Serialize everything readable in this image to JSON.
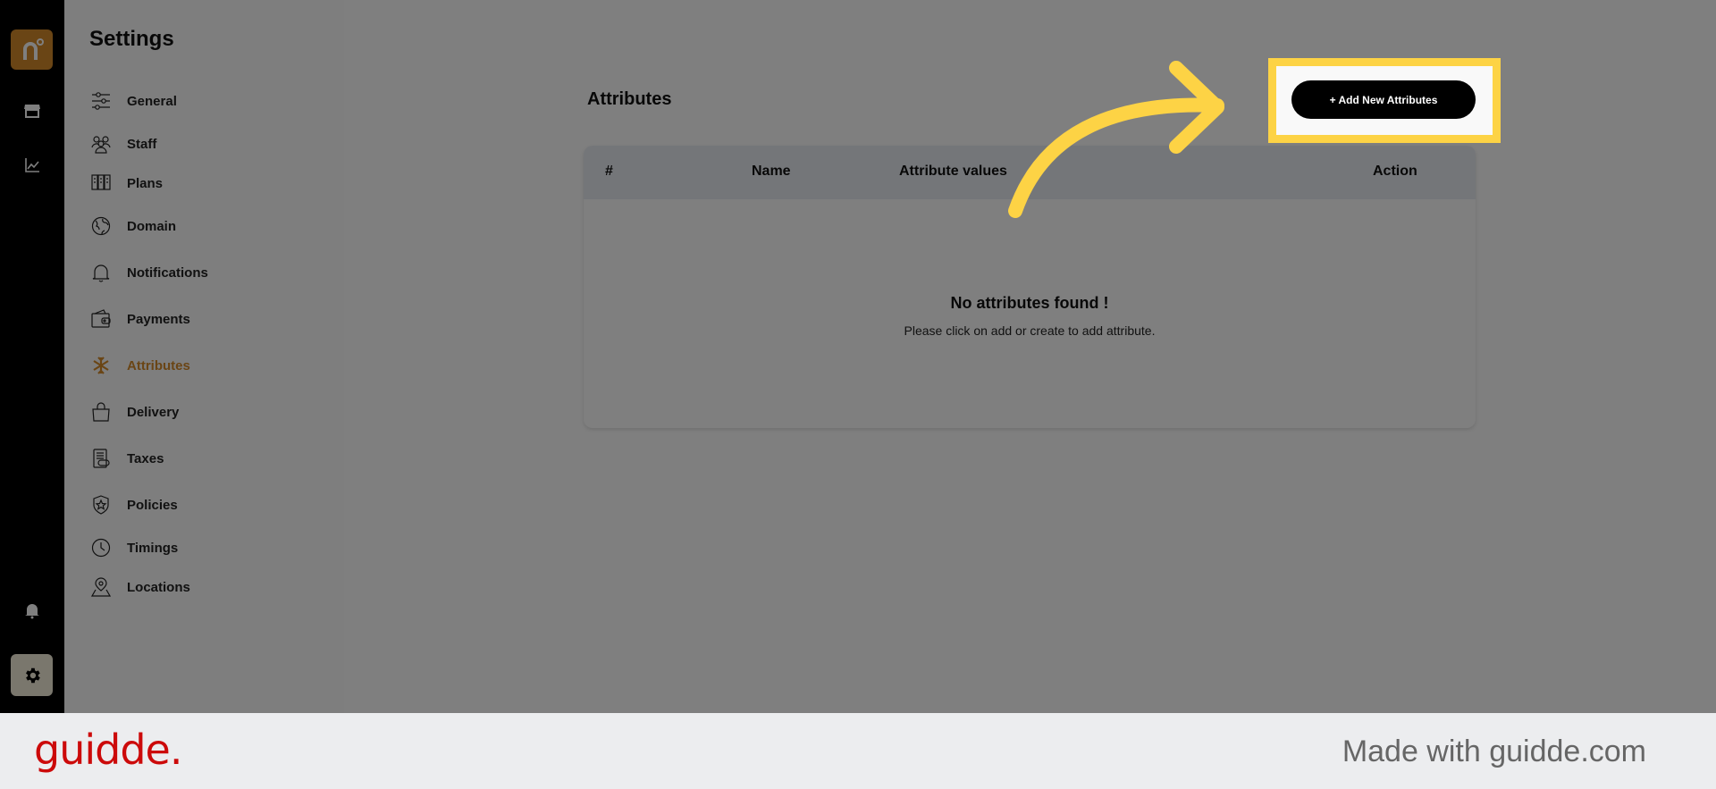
{
  "rail": {
    "items": [
      {
        "name": "store-icon"
      },
      {
        "name": "analytics-icon"
      },
      {
        "name": "bell-icon"
      },
      {
        "name": "gear-icon",
        "active": true
      }
    ]
  },
  "settings": {
    "title": "Settings",
    "items": [
      {
        "label": "General",
        "icon": "sliders-icon"
      },
      {
        "label": "Staff",
        "icon": "staff-icon"
      },
      {
        "label": "Plans",
        "icon": "plans-icon"
      },
      {
        "label": "Domain",
        "icon": "globe-icon"
      },
      {
        "label": "Notifications",
        "icon": "bell-icon"
      },
      {
        "label": "Payments",
        "icon": "wallet-icon"
      },
      {
        "label": "Attributes",
        "icon": "snowflake-icon",
        "active": true
      },
      {
        "label": "Delivery",
        "icon": "bag-icon"
      },
      {
        "label": "Taxes",
        "icon": "tax-icon"
      },
      {
        "label": "Policies",
        "icon": "shield-star-icon"
      },
      {
        "label": "Timings",
        "icon": "clock-icon"
      },
      {
        "label": "Locations",
        "icon": "location-icon"
      }
    ]
  },
  "main": {
    "title": "Attributes",
    "add_button": "+ Add New Attributes",
    "table": {
      "columns": [
        "#",
        "Name",
        "Attribute values",
        "Action"
      ],
      "empty_title": "No attributes found !",
      "empty_subtitle": "Please click on add or create to add attribute."
    }
  },
  "colors": {
    "accent": "#d58a2a",
    "highlight": "#fdd345",
    "brand_red": "#cc0a0a"
  },
  "footer": {
    "brand": "guidde.",
    "made_with": "Made with guidde.com"
  }
}
